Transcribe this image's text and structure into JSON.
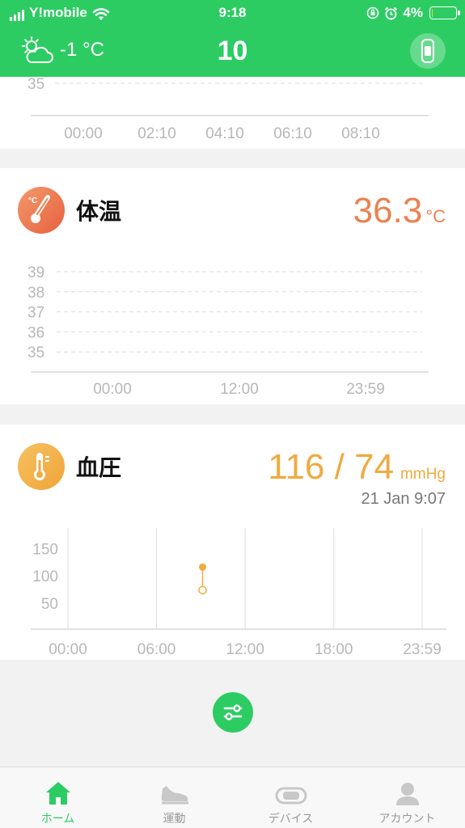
{
  "status_bar": {
    "carrier": "Y!mobile",
    "time": "9:18",
    "battery": "4%",
    "battery_level": 0.04
  },
  "header": {
    "weather_icon": "partly-cloudy-icon",
    "temperature": "-1 °C",
    "date_number": "10",
    "device_icon": "band-icon"
  },
  "top_chart": {
    "chart_data": {
      "type": "line",
      "y_ticks": [
        "35"
      ],
      "x_ticks": [
        "00:00",
        "02:10",
        "04:10",
        "06:10",
        "08:10"
      ],
      "series": []
    }
  },
  "temperature_card": {
    "icon": "thermometer-icon",
    "title": "体温",
    "value": "36.3",
    "unit": "°C",
    "chart_data": {
      "type": "line",
      "y_ticks": [
        "39",
        "38",
        "37",
        "36",
        "35"
      ],
      "x_ticks": [
        "00:00",
        "12:00",
        "23:59"
      ],
      "series": []
    }
  },
  "blood_pressure_card": {
    "icon": "thermometer-icon",
    "title": "血圧",
    "systolic": "116",
    "separator": "/",
    "diastolic": "74",
    "unit": "mmHg",
    "measured_at": "21 Jan 9:07",
    "colors": {
      "accent": "#f0aa3e"
    },
    "chart_data": {
      "type": "scatter",
      "y_ticks": [
        "150",
        "100",
        "50"
      ],
      "x_ticks": [
        "00:00",
        "06:00",
        "12:00",
        "18:00",
        "23:59"
      ],
      "points": [
        {
          "time": "9:07",
          "systolic": 116,
          "diastolic": 74
        }
      ]
    }
  },
  "fab": {
    "icon": "sliders-icon"
  },
  "tabs": [
    {
      "label": "ホーム",
      "icon": "home-icon",
      "active": true
    },
    {
      "label": "運動",
      "icon": "shoe-icon",
      "active": false
    },
    {
      "label": "デバイス",
      "icon": "band-icon",
      "active": false
    },
    {
      "label": "アカウント",
      "icon": "user-icon",
      "active": false
    }
  ],
  "colors": {
    "brand": "#2dcc63",
    "temperature": "#ec8152",
    "blood_pressure": "#f0aa3e"
  }
}
